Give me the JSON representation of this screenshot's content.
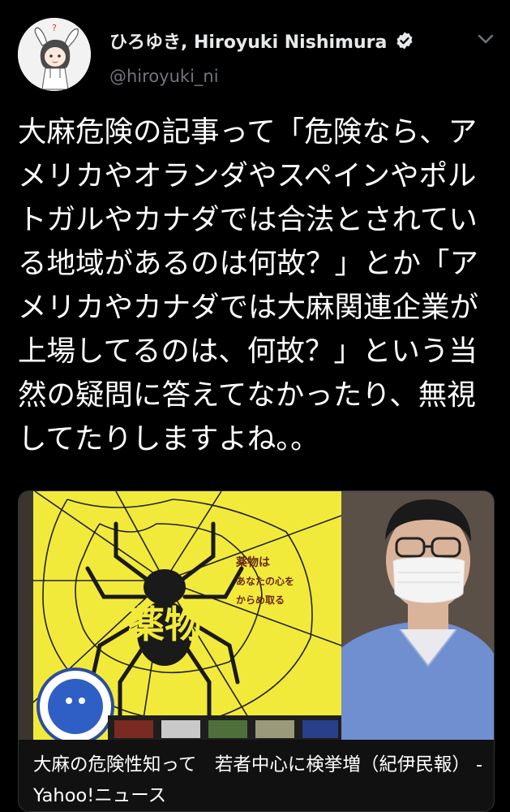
{
  "author": {
    "display_name": "ひろゆき, Hiroyuki Nishimura",
    "handle": "@hiroyuki_ni",
    "avatar_icon": "avatar-illustration",
    "verified_icon": "verified-badge-icon",
    "menu_icon": "chevron-down-icon"
  },
  "tweet": {
    "text": "大麻危険の記事って「危険なら、アメリカやオランダやスペインやポルトガルやカナダでは合法とされている地域があるのは何故？」とか「アメリカやカナダでは大麻関連企業が上場してるのは、何故？」という当然の疑問に答えてなかったり、無視してたりしますよね。。"
  },
  "card": {
    "poster_kanji": "薬物",
    "poster_slogan_1": "薬物は",
    "poster_slogan_2": "あなたの心を",
    "poster_slogan_3": "からめ取る",
    "caption": "大麻の危険性知って　若者中心に検挙増（紀伊民報） - Yahoo!ニュース"
  },
  "colors": {
    "background": "#000000",
    "text": "#ffffff",
    "secondary_text": "#6e767d",
    "poster_yellow": "#f2ea3b",
    "slogan_text": "#6b2a1a"
  }
}
